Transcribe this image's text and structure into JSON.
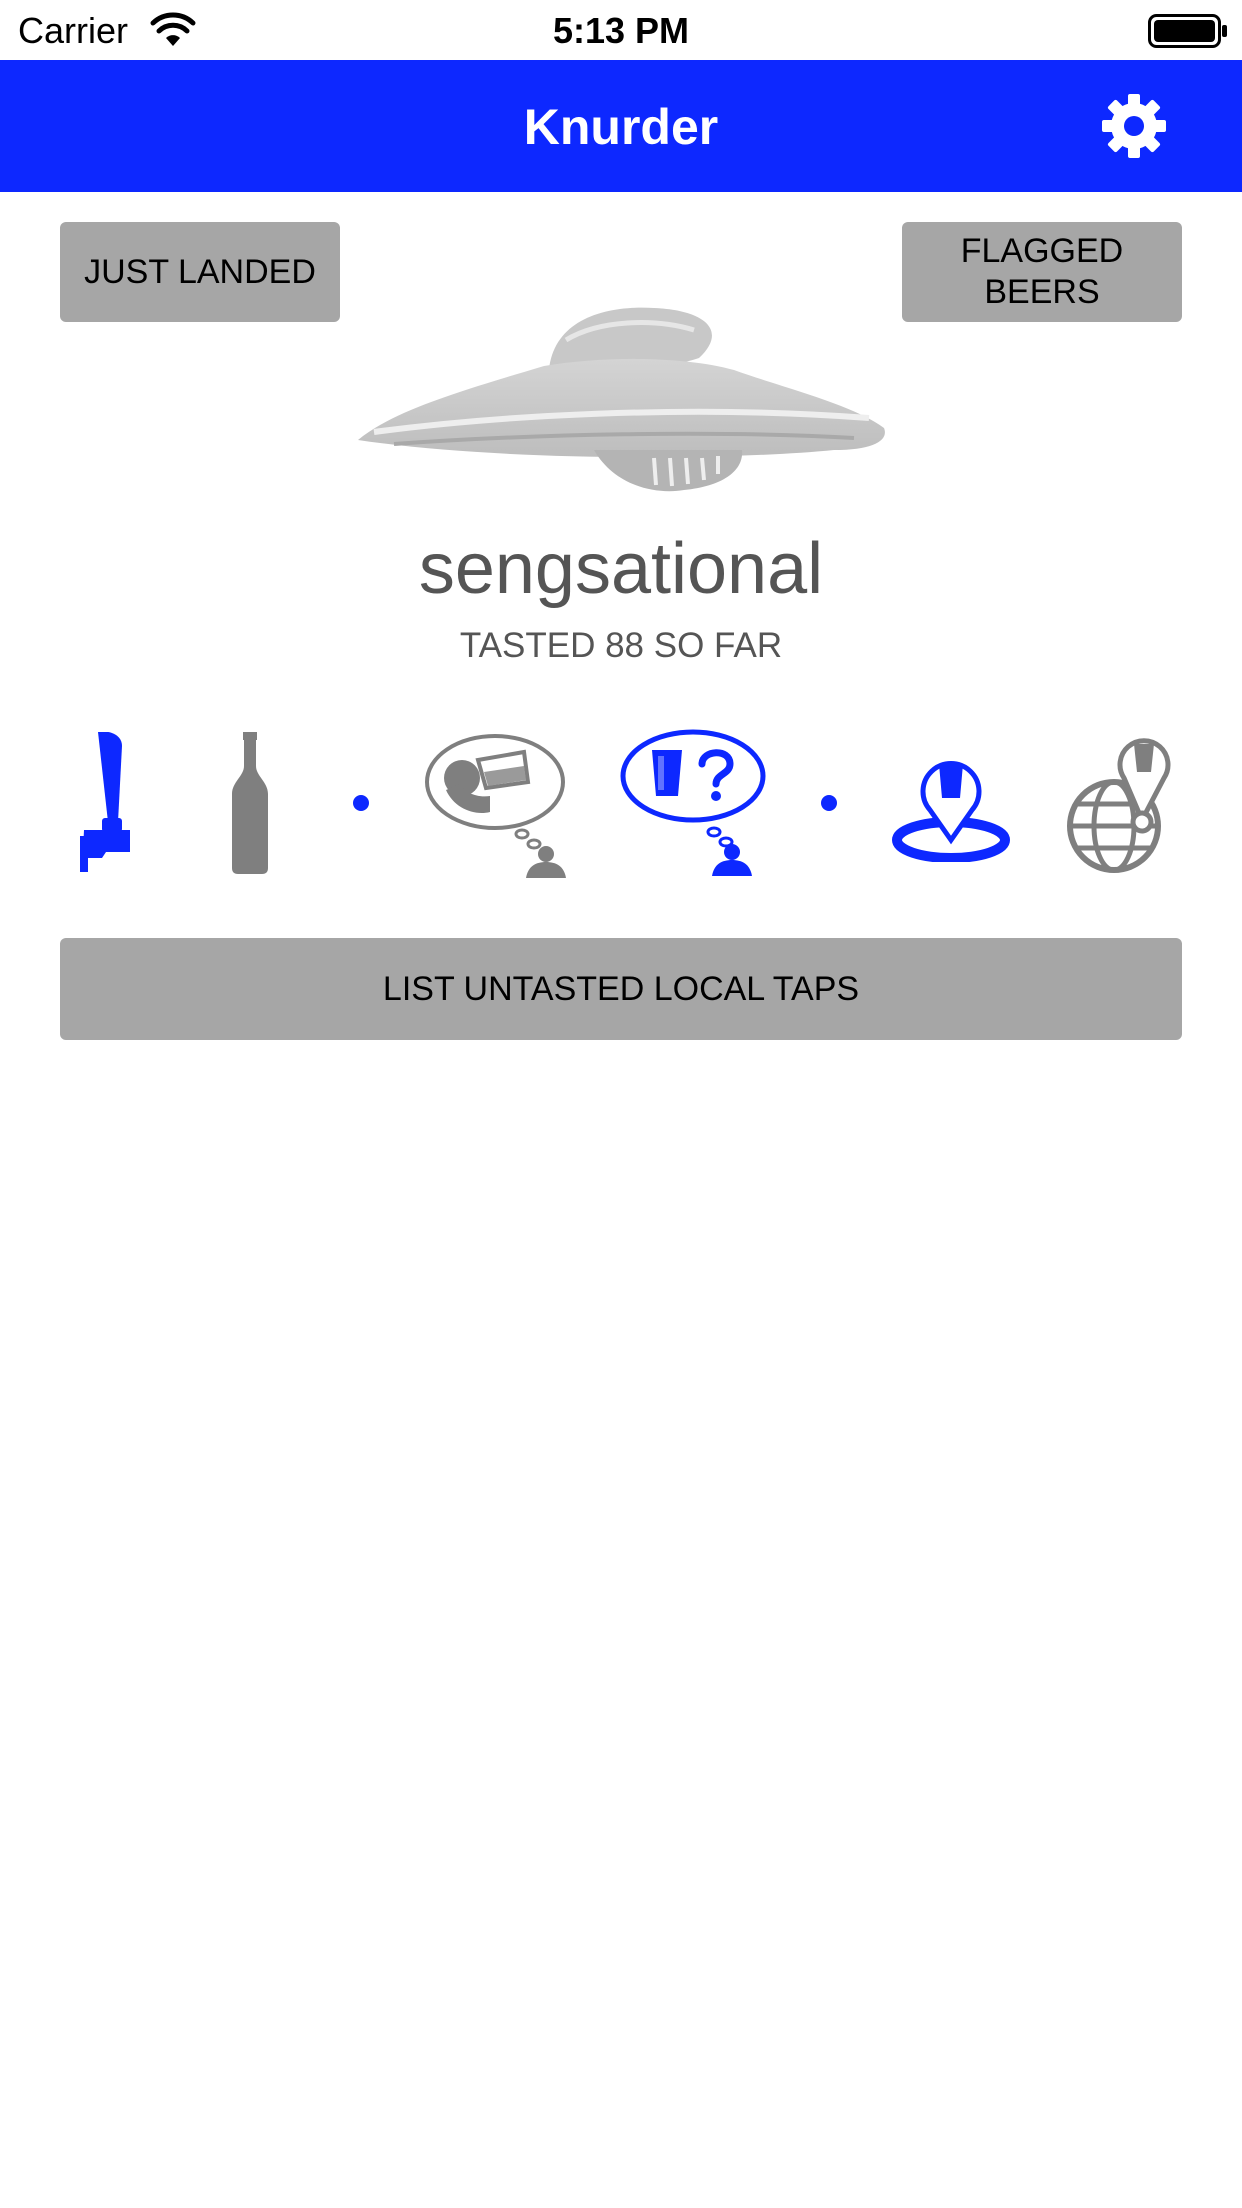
{
  "status_bar": {
    "carrier": "Carrier",
    "time": "5:13 PM"
  },
  "nav": {
    "title": "Knurder",
    "settings_icon": "gear-icon"
  },
  "buttons": {
    "just_landed": "JUST LANDED",
    "flagged_beers_line1": "FLAGGED",
    "flagged_beers_line2": "BEERS",
    "list_untasted": "LIST UNTASTED LOCAL TAPS"
  },
  "user": {
    "name": "sengsational",
    "tasted_text": "TASTED 88 SO FAR"
  },
  "filters": {
    "container": [
      {
        "icon": "tap-handle-icon",
        "selected": true
      },
      {
        "icon": "bottle-icon",
        "selected": false
      }
    ],
    "tasted": [
      {
        "icon": "tasted-beer-icon",
        "selected": false
      },
      {
        "icon": "untasted-beer-icon",
        "selected": true
      }
    ],
    "location": [
      {
        "icon": "local-location-icon",
        "selected": true
      },
      {
        "icon": "global-location-icon",
        "selected": false
      }
    ]
  },
  "colors": {
    "accent": "#0d28ff",
    "button_gray": "#a6a6a6",
    "icon_inactive": "#7f7f7f",
    "text_gray": "#555555"
  }
}
